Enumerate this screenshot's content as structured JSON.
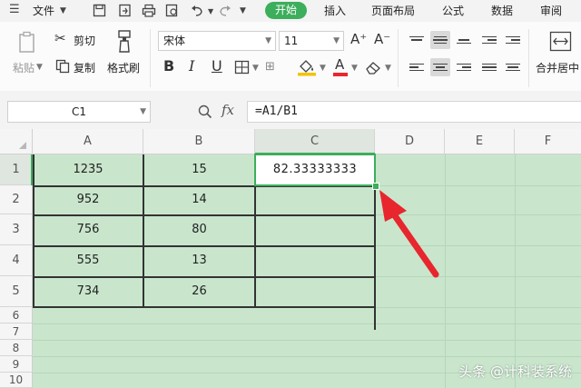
{
  "colors": {
    "accent_green": "#3cae5c",
    "grid_fill": "#c9e6cd",
    "arrow_red": "#e8262d"
  },
  "menubar": {
    "file_label": "文件",
    "tabs": [
      "开始",
      "插入",
      "页面布局",
      "公式",
      "数据",
      "审阅"
    ]
  },
  "ribbon": {
    "paste_label": "粘贴",
    "cut_label": "剪切",
    "copy_label": "复制",
    "format_painter_label": "格式刷",
    "font_name": "宋体",
    "font_size": "11",
    "bold": "B",
    "italic": "I",
    "underline": "U",
    "font_color_glyph": "A",
    "grow_font": "A⁺",
    "shrink_font": "A⁻",
    "merge_label": "合并居中"
  },
  "formula_bar": {
    "name_box": "C1",
    "fx_label": "fx",
    "formula": "=A1/B1"
  },
  "sheet": {
    "columns": [
      "A",
      "B",
      "C",
      "D",
      "E",
      "F"
    ],
    "rows": [
      "1",
      "2",
      "3",
      "4",
      "5",
      "6",
      "7",
      "8",
      "9",
      "10"
    ],
    "data": [
      [
        "1235",
        "15",
        "82.33333333"
      ],
      [
        "952",
        "14",
        ""
      ],
      [
        "756",
        "80",
        ""
      ],
      [
        "555",
        "13",
        ""
      ],
      [
        "734",
        "26",
        ""
      ]
    ],
    "selected_cell": "C1"
  },
  "watermark": "头条 @计科装系统"
}
